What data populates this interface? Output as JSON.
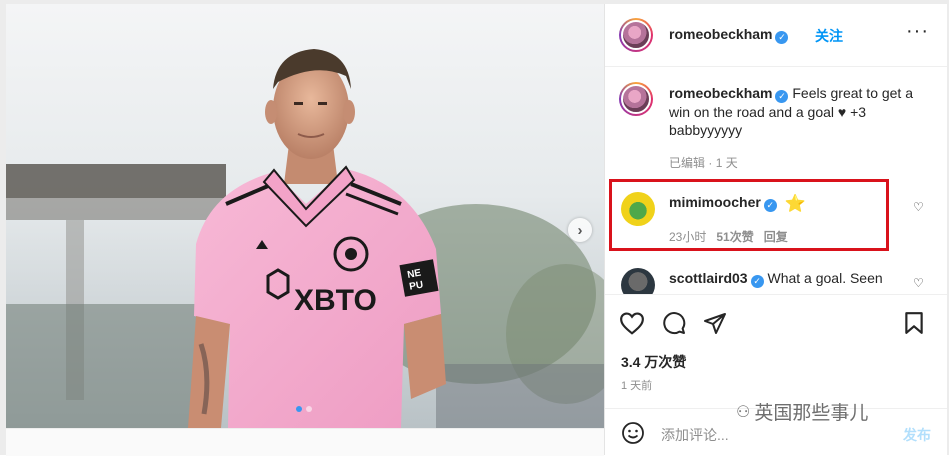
{
  "post": {
    "username": "romeobeckham",
    "follow_label": "关注",
    "more_label": "···",
    "caption_text": "Feels great to get a win on the road and a goal ♥ +3 babbyyyyyy",
    "caption_meta_edited": "已编辑",
    "caption_meta_time": "1 天",
    "likes": "3.4 万次赞",
    "posted_time": "1 天前",
    "add_comment_placeholder": "添加评论...",
    "post_button": "发布"
  },
  "media": {
    "jersey_sponsor": "XBTO",
    "sleeve_patch": "NE\nPU",
    "next_arrow": "›",
    "page_indicator": {
      "current": 1,
      "total": 2
    }
  },
  "comments": [
    {
      "username": "mimimoocher",
      "text": "⭐",
      "time": "23小时",
      "likes": "51次赞",
      "reply": "回复",
      "highlighted": true
    },
    {
      "username": "scottlaird03",
      "text": "What a goal. Seen",
      "highlighted": false
    }
  ],
  "watermark": {
    "text": "英国那些事儿",
    "icon": "wechat-icon"
  },
  "colors": {
    "accent": "#0095f6",
    "verified": "#3897f0",
    "highlight_border": "#d9121b",
    "jersey_pink": "#f4a7c9",
    "muted_text": "#8e8e8e"
  },
  "icons": [
    "heart-icon",
    "comment-icon",
    "share-icon",
    "bookmark-icon",
    "emoji-icon",
    "more-icon",
    "verified-icon"
  ]
}
